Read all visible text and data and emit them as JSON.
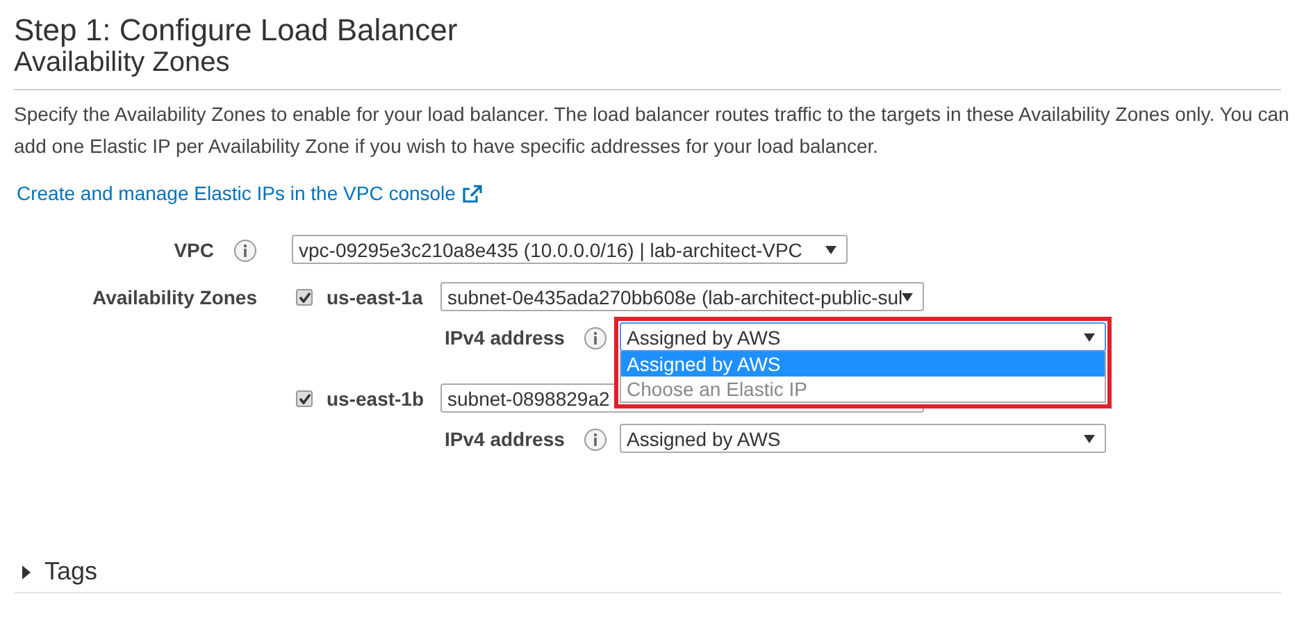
{
  "heading": "Step 1: Configure Load Balancer",
  "section_title": "Availability Zones",
  "description": "Specify the Availability Zones to enable for your load balancer. The load balancer routes traffic to the targets in these Availability Zones only. You can add one Elastic IP per Availability Zone if you wish to have specific addresses for your load balancer.",
  "link": "Create and manage Elastic IPs in the VPC console",
  "vpc": {
    "label": "VPC",
    "value": "vpc-09295e3c210a8e435 (10.0.0.0/16) | lab-architect-VPC"
  },
  "zones_label": "Availability Zones",
  "zones": [
    {
      "name": "us-east-1a",
      "checked": true,
      "subnet": "subnet-0e435ada270bb608e (lab-architect-public-sul",
      "ipv4_label": "IPv4 address",
      "ipv4_value": "Assigned by AWS",
      "open": true,
      "highlighted": true,
      "options": [
        {
          "label": "Assigned by AWS",
          "selected": true
        },
        {
          "label": "Choose an Elastic IP",
          "selected": false
        }
      ]
    },
    {
      "name": "us-east-1b",
      "checked": true,
      "subnet": "subnet-0898829a2",
      "ipv4_label": "IPv4 address",
      "ipv4_value": "Assigned by AWS"
    }
  ],
  "tags": {
    "label": "Tags",
    "expanded": false
  }
}
